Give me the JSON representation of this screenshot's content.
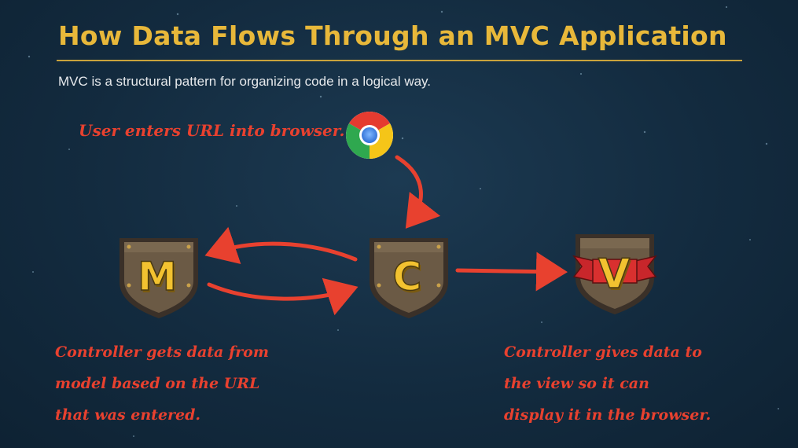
{
  "title": "How Data Flows Through an MVC Application",
  "subtitle": "MVC is a structural pattern for organizing code in a logical way.",
  "annotations": {
    "user_enters_url": "User enters URL into browser.",
    "controller_gets_data": "Controller gets data from\nmodel based on the URL\nthat was entered.",
    "controller_gives_data": "Controller gives data to\nthe view so it can\ndisplay it in the browser."
  },
  "badges": {
    "model": "M",
    "controller": "C",
    "view": "V"
  },
  "icons": {
    "browser": "chrome-browser-icon",
    "model_badge": "model-shield-icon",
    "controller_badge": "controller-shield-icon",
    "view_badge": "view-shield-icon"
  },
  "colors": {
    "title": "#e8b83a",
    "annotation": "#e8412f",
    "arrow": "#e8412f",
    "badge_letter": "#f2c230",
    "shield": "#6b5a45",
    "ribbon": "#c8262b"
  }
}
